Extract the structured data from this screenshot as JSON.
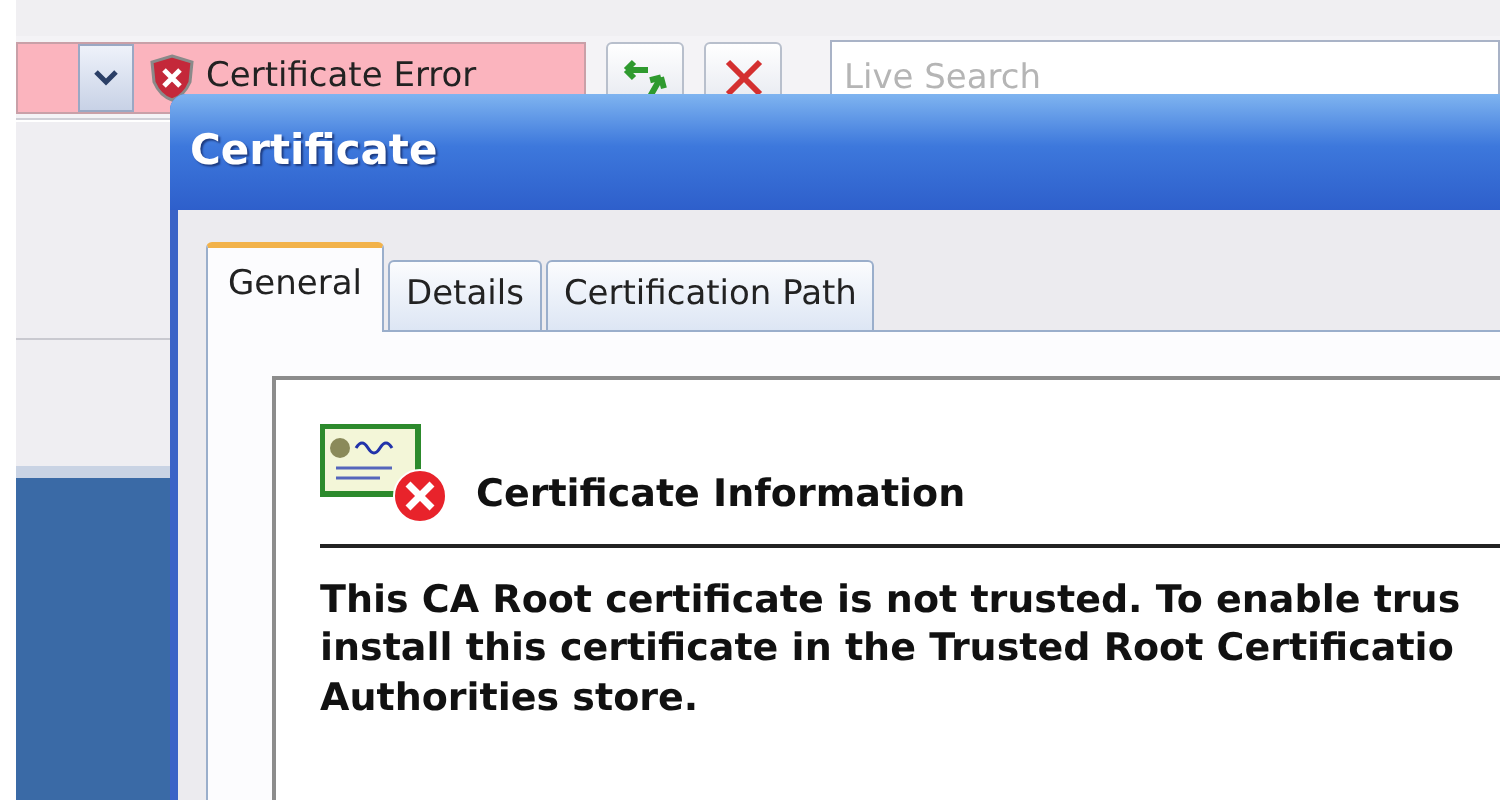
{
  "browser": {
    "address_status": "Certificate Error",
    "search": {
      "placeholder": "Live Search"
    }
  },
  "dialog": {
    "title": "Certificate",
    "tabs": [
      {
        "label": "General",
        "selected": true
      },
      {
        "label": "Details",
        "selected": false
      },
      {
        "label": "Certification Path",
        "selected": false
      }
    ],
    "heading": "Certificate Information",
    "message_lines": [
      "This CA Root certificate is not trusted. To enable trus",
      "install this certificate in the Trusted Root Certificatio",
      "Authorities store."
    ]
  }
}
